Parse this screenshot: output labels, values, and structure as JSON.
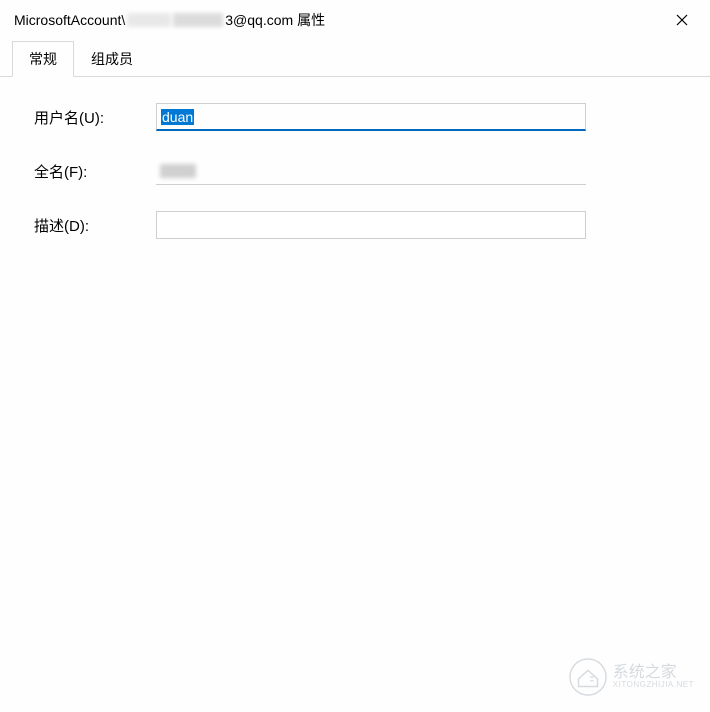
{
  "titlebar": {
    "prefix": "MicrosoftAccount\\",
    "suffix": "3@qq.com 属性"
  },
  "tabs": {
    "general": "常规",
    "members": "组成员"
  },
  "form": {
    "username_label": "用户名(U):",
    "username_value": "duan",
    "fullname_label": "全名(F):",
    "description_label": "描述(D):",
    "description_value": ""
  },
  "watermark": {
    "main": "系统之家",
    "sub": "XITONGZHIJIA.NET"
  }
}
